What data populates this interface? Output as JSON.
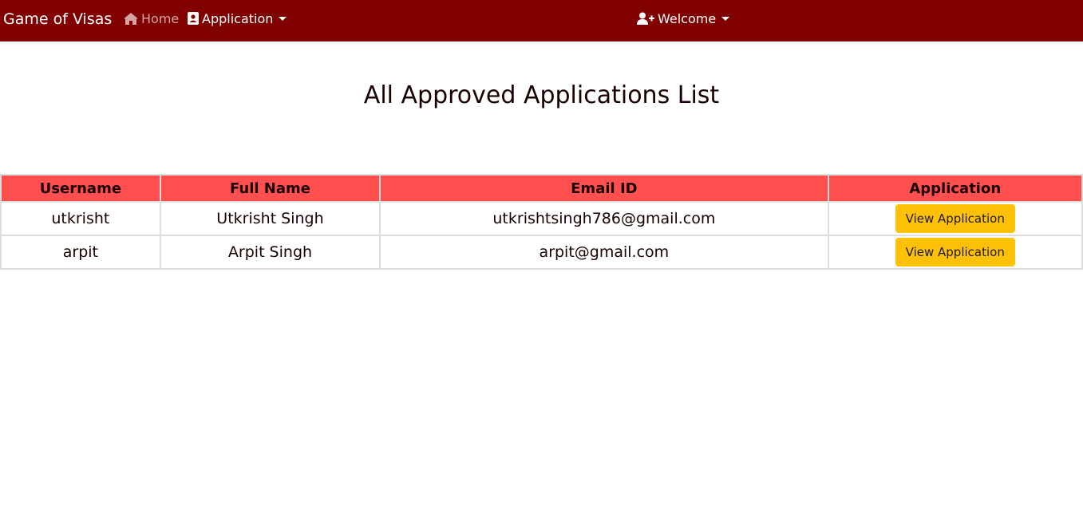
{
  "navbar": {
    "brand": "Game of Visas",
    "home_label": "Home",
    "application_label": "Application",
    "welcome_label": "Welcome",
    "background_color": "#800000"
  },
  "page": {
    "title": "All Approved Applications List"
  },
  "table": {
    "header_color": "#ff4f4f",
    "columns": [
      "Username",
      "Full Name",
      "Email ID",
      "Application"
    ],
    "rows": [
      {
        "username": "utkrisht",
        "full_name": "Utkrisht Singh",
        "email": "utkrishtsingh786@gmail.com",
        "action_label": "View Application"
      },
      {
        "username": "arpit",
        "full_name": "Arpit Singh",
        "email": "arpit@gmail.com",
        "action_label": "View Application"
      }
    ]
  },
  "icons": {
    "home": "home-icon",
    "application": "address-book-icon",
    "welcome": "user-plus-icon"
  }
}
